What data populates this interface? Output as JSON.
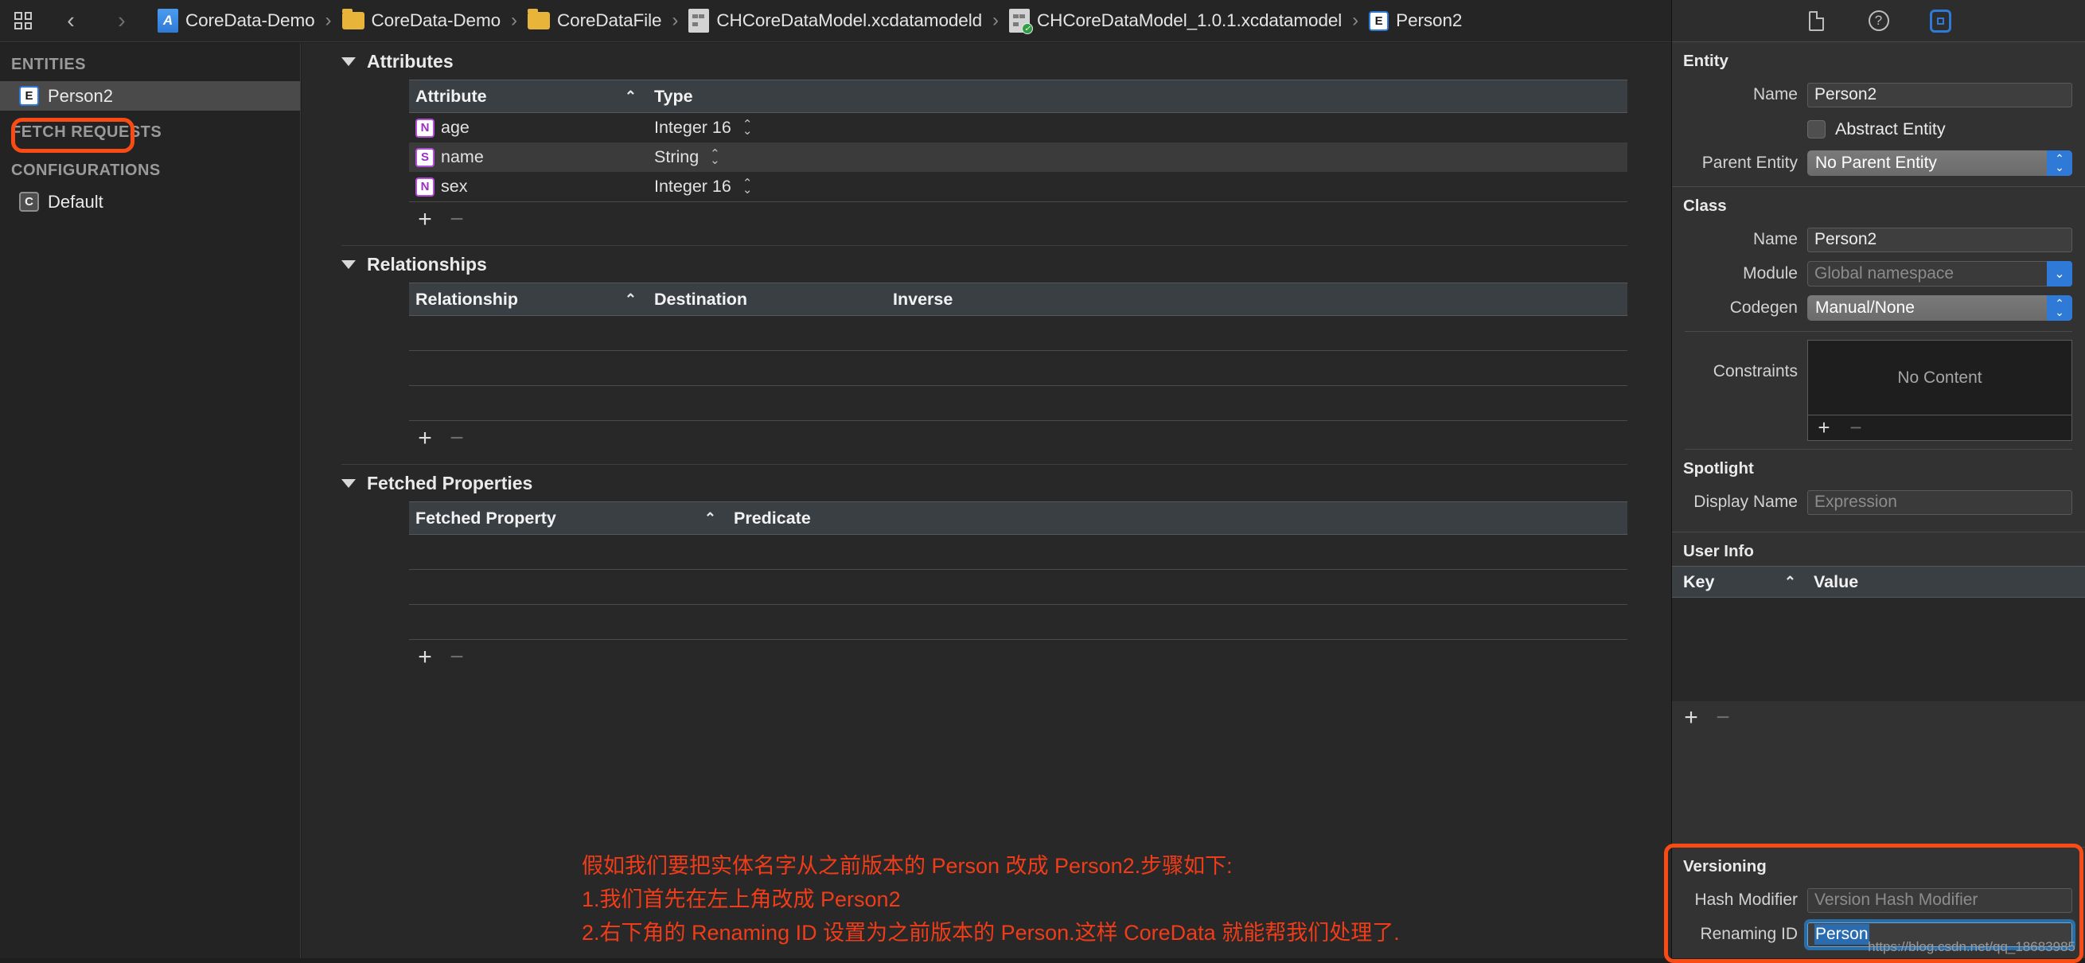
{
  "titlebar": {
    "breadcrumbs": [
      {
        "icon": "app-icon",
        "label": "CoreData-Demo"
      },
      {
        "icon": "folder-icon",
        "label": "CoreData-Demo"
      },
      {
        "icon": "folder-icon",
        "label": "CoreDataFile"
      },
      {
        "icon": "datamodeld-icon",
        "label": "CHCoreDataModel.xcdatamodeld"
      },
      {
        "icon": "datamodel-checked-icon",
        "label": "CHCoreDataModel_1.0.1.xcdatamodel"
      },
      {
        "icon": "entity-icon",
        "label": "Person2"
      }
    ],
    "nav_back": "‹",
    "nav_forward": "›"
  },
  "sidebar": {
    "groups": [
      {
        "header": "ENTITIES",
        "items": [
          {
            "badge": "E",
            "label": "Person2",
            "selected": true
          }
        ]
      },
      {
        "header": "FETCH REQUESTS",
        "items": []
      },
      {
        "header": "CONFIGURATIONS",
        "items": [
          {
            "badge": "C",
            "label": "Default",
            "selected": false
          }
        ]
      }
    ]
  },
  "editor": {
    "attributes": {
      "title": "Attributes",
      "columns": [
        "Attribute",
        "Type"
      ],
      "sort_caret": "⌃",
      "rows": [
        {
          "badge": "N",
          "name": "age",
          "type": "Integer 16"
        },
        {
          "badge": "S",
          "name": "name",
          "type": "String"
        },
        {
          "badge": "N",
          "name": "sex",
          "type": "Integer 16"
        }
      ],
      "add_label": "+",
      "remove_label": "−"
    },
    "relationships": {
      "title": "Relationships",
      "columns": [
        "Relationship",
        "Destination",
        "Inverse"
      ],
      "sort_caret": "⌃",
      "rows": [],
      "add_label": "+",
      "remove_label": "−"
    },
    "fetched_properties": {
      "title": "Fetched Properties",
      "columns": [
        "Fetched Property",
        "Predicate"
      ],
      "sort_caret": "⌃",
      "rows": [],
      "add_label": "+",
      "remove_label": "−"
    },
    "annotation": "假如我们要把实体名字从之前版本的 Person 改成 Person2.步骤如下:\n1.我们首先在左上角改成 Person2\n2.右下角的 Renaming ID 设置为之前版本的 Person.这样 CoreData 就能帮我们处理了."
  },
  "inspector": {
    "tabs": [
      {
        "icon": "document-icon",
        "active": false
      },
      {
        "icon": "help-icon",
        "active": false
      },
      {
        "icon": "coredata-inspector-icon",
        "active": true
      }
    ],
    "entity": {
      "title": "Entity",
      "name_label": "Name",
      "name_value": "Person2",
      "abstract_label": "Abstract Entity",
      "abstract_checked": false,
      "parent_label": "Parent Entity",
      "parent_value": "No Parent Entity"
    },
    "klass": {
      "title": "Class",
      "name_label": "Name",
      "name_value": "Person2",
      "module_label": "Module",
      "module_placeholder": "Global namespace",
      "codegen_label": "Codegen",
      "codegen_value": "Manual/None",
      "constraints_label": "Constraints",
      "constraints_empty": "No Content",
      "add_label": "+",
      "remove_label": "−"
    },
    "spotlight": {
      "title": "Spotlight",
      "display_name_label": "Display Name",
      "display_name_placeholder": "Expression"
    },
    "user_info": {
      "title": "User Info",
      "columns": [
        "Key",
        "Value"
      ],
      "sort_caret": "⌃",
      "rows": [],
      "add_label": "+",
      "remove_label": "−"
    },
    "versioning": {
      "title": "Versioning",
      "hash_modifier_label": "Hash Modifier",
      "hash_modifier_placeholder": "Version Hash Modifier",
      "renaming_id_label": "Renaming ID",
      "renaming_id_value": "Person",
      "renaming_id_focused": true
    }
  },
  "watermark": "https://blog.csdn.net/qq_18683985",
  "colors": {
    "accent_blue": "#2f7ad6",
    "highlight_orange": "#fb4b14",
    "annotation_red": "#f03c18",
    "attribute_badge_purple": "#b34fd6"
  }
}
